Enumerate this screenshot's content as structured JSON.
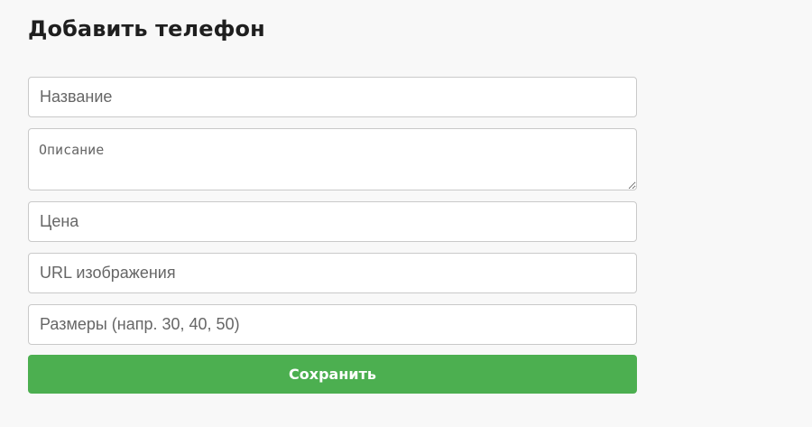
{
  "page": {
    "title": "Добавить телефон"
  },
  "form": {
    "name_placeholder": "Название",
    "description_placeholder": "Описание",
    "price_placeholder": "Цена",
    "image_url_placeholder": "URL изображения",
    "sizes_placeholder": "Размеры (напр. 30, 40, 50)",
    "save_label": "Сохранить"
  },
  "colors": {
    "background": "#f8f8f8",
    "accent": "#4caf50",
    "button_text": "#ffffff",
    "border": "#c9c9c9"
  }
}
